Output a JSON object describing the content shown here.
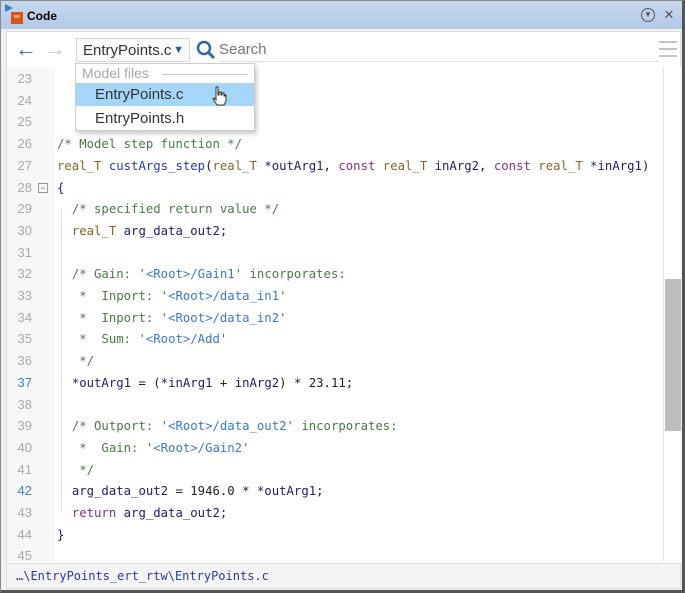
{
  "window": {
    "title": "Code",
    "menu_icon": "circle-down-arrow-icon",
    "close_icon": "close-icon"
  },
  "toolbar": {
    "back": "←",
    "forward": "→",
    "file_selected": "EntryPoints.c",
    "search_placeholder": "Search"
  },
  "dropdown": {
    "header": "Model files",
    "items": [
      "EntryPoints.c",
      "EntryPoints.h"
    ],
    "hovered": "EntryPoints.c"
  },
  "colors": {
    "comment": "#4b7a47",
    "type": "#8a6420",
    "function": "#2a3aa6",
    "keyword": "#8b2f86",
    "identifier": "#1c1c6e",
    "link": "#3a7bc0",
    "selection": "#a6d6f7",
    "highlight_line": "#3a86c8"
  },
  "code": {
    "lines": [
      {
        "n": "23",
        "t": []
      },
      {
        "n": "24",
        "t": []
      },
      {
        "n": "25",
        "t": []
      },
      {
        "n": "26",
        "t": [
          [
            "com",
            "/* Model step function */"
          ]
        ]
      },
      {
        "n": "27",
        "t": [
          [
            "type",
            "real_T"
          ],
          [
            "pl",
            " "
          ],
          [
            "fn",
            "custArgs_step"
          ],
          [
            "pl",
            "("
          ],
          [
            "type",
            "real_T"
          ],
          [
            "pl",
            " "
          ],
          [
            "id",
            "*outArg1"
          ],
          [
            "pl",
            ", "
          ],
          [
            "kw",
            "const"
          ],
          [
            "pl",
            " "
          ],
          [
            "type",
            "real_T"
          ],
          [
            "pl",
            " "
          ],
          [
            "id",
            "inArg2"
          ],
          [
            "pl",
            ", "
          ],
          [
            "kw",
            "const"
          ],
          [
            "pl",
            " "
          ],
          [
            "type",
            "real_T"
          ],
          [
            "pl",
            " "
          ],
          [
            "id",
            "*inArg1"
          ],
          [
            "pl",
            ")"
          ]
        ]
      },
      {
        "n": "28",
        "fold": true,
        "t": [
          [
            "id",
            "{"
          ]
        ]
      },
      {
        "n": "29",
        "t": [
          [
            "pl",
            "  "
          ],
          [
            "com",
            "/* specified return value */"
          ]
        ]
      },
      {
        "n": "30",
        "t": [
          [
            "pl",
            "  "
          ],
          [
            "type",
            "real_T"
          ],
          [
            "pl",
            " "
          ],
          [
            "id",
            "arg_data_out2"
          ],
          [
            "pl",
            ";"
          ]
        ]
      },
      {
        "n": "31",
        "t": []
      },
      {
        "n": "32",
        "t": [
          [
            "pl",
            "  "
          ],
          [
            "com",
            "/* Gain: '"
          ],
          [
            "link",
            "<Root>/Gain1"
          ],
          [
            "com",
            "' incorporates:"
          ]
        ]
      },
      {
        "n": "33",
        "t": [
          [
            "pl",
            "  "
          ],
          [
            "com",
            " *  Inport: '"
          ],
          [
            "link",
            "<Root>/data_in1"
          ],
          [
            "com",
            "'"
          ]
        ]
      },
      {
        "n": "34",
        "t": [
          [
            "pl",
            "  "
          ],
          [
            "com",
            " *  Inport: '"
          ],
          [
            "link",
            "<Root>/data_in2"
          ],
          [
            "com",
            "'"
          ]
        ]
      },
      {
        "n": "35",
        "t": [
          [
            "pl",
            "  "
          ],
          [
            "com",
            " *  Sum: '"
          ],
          [
            "link",
            "<Root>/Add"
          ],
          [
            "com",
            "'"
          ]
        ]
      },
      {
        "n": "36",
        "t": [
          [
            "pl",
            "  "
          ],
          [
            "com",
            " */"
          ]
        ]
      },
      {
        "n": "37",
        "hl": true,
        "t": [
          [
            "pl",
            "  "
          ],
          [
            "id",
            "*outArg1"
          ],
          [
            "pl",
            " = ("
          ],
          [
            "id",
            "*inArg1"
          ],
          [
            "pl",
            " + "
          ],
          [
            "id",
            "inArg2"
          ],
          [
            "pl",
            ") * 23.11;"
          ]
        ]
      },
      {
        "n": "38",
        "t": []
      },
      {
        "n": "39",
        "t": [
          [
            "pl",
            "  "
          ],
          [
            "com",
            "/* Outport: '"
          ],
          [
            "link",
            "<Root>/data_out2"
          ],
          [
            "com",
            "' incorporates:"
          ]
        ]
      },
      {
        "n": "40",
        "t": [
          [
            "pl",
            "  "
          ],
          [
            "com",
            " *  Gain: '"
          ],
          [
            "link",
            "<Root>/Gain2"
          ],
          [
            "com",
            "'"
          ]
        ]
      },
      {
        "n": "41",
        "t": [
          [
            "pl",
            "  "
          ],
          [
            "com",
            " */"
          ]
        ]
      },
      {
        "n": "42",
        "hl": true,
        "t": [
          [
            "pl",
            "  "
          ],
          [
            "id",
            "arg_data_out2"
          ],
          [
            "pl",
            " = 1946.0 * "
          ],
          [
            "id",
            "*outArg1"
          ],
          [
            "pl",
            ";"
          ]
        ]
      },
      {
        "n": "43",
        "t": [
          [
            "pl",
            "  "
          ],
          [
            "kw",
            "return"
          ],
          [
            "pl",
            " "
          ],
          [
            "id",
            "arg_data_out2"
          ],
          [
            "pl",
            ";"
          ]
        ]
      },
      {
        "n": "44",
        "t": [
          [
            "id",
            "}"
          ]
        ]
      },
      {
        "n": "45",
        "t": []
      }
    ]
  },
  "scrollbar": {
    "position_fraction": 0.45
  },
  "footer": {
    "path": "…\\EntryPoints_ert_rtw\\EntryPoints.c"
  }
}
